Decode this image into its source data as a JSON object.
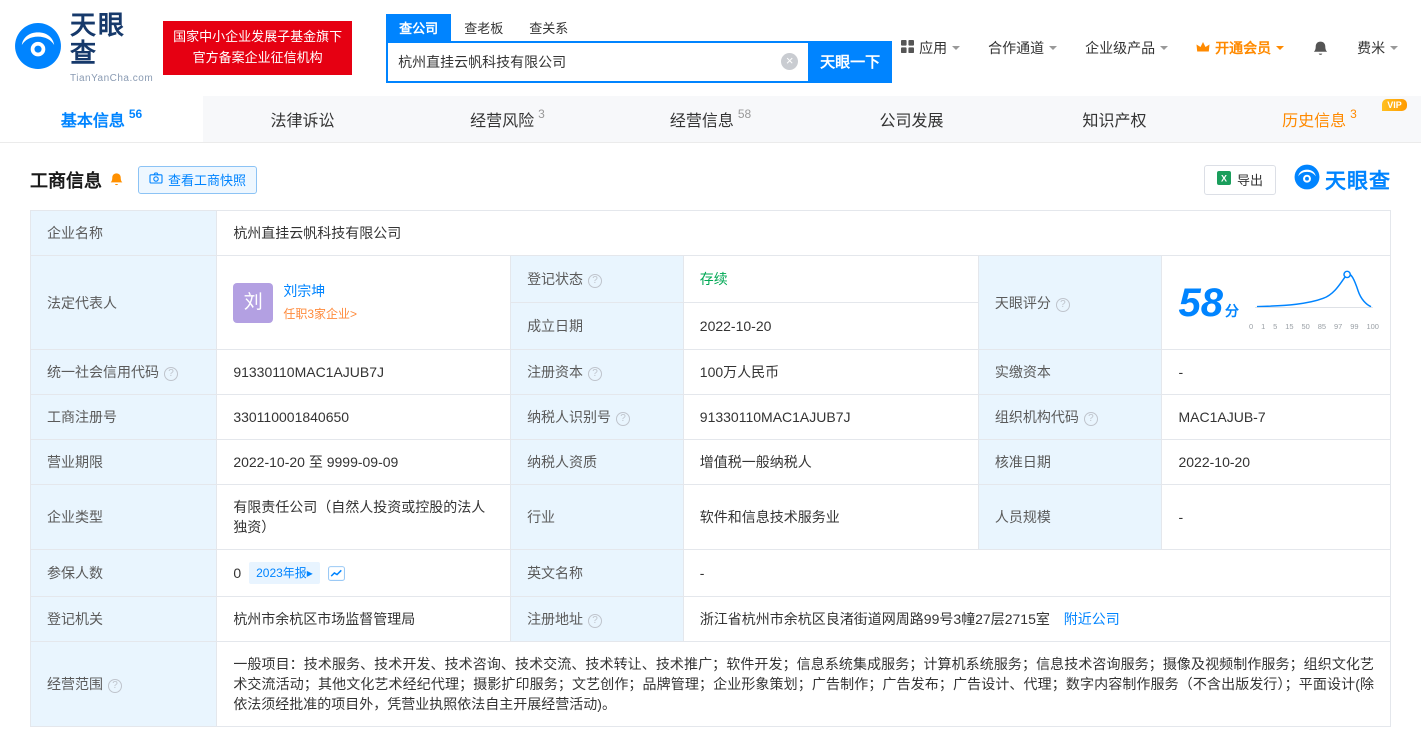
{
  "brand": {
    "logo_text": "天眼查",
    "logo_domain": "TianYanCha.com",
    "badge_line1": "国家中小企业发展子基金旗下",
    "badge_line2": "官方备案企业征信机构"
  },
  "search": {
    "tabs": [
      {
        "label": "查公司"
      },
      {
        "label": "查老板"
      },
      {
        "label": "查关系"
      }
    ],
    "value": "杭州直挂云帆科技有限公司",
    "button": "天眼一下"
  },
  "nav": {
    "items": [
      {
        "label": "应用"
      },
      {
        "label": "合作通道"
      },
      {
        "label": "企业级产品"
      },
      {
        "label": "开通会员"
      },
      {
        "label": "费米"
      }
    ]
  },
  "tabs": [
    {
      "label": "基本信息",
      "count": "56"
    },
    {
      "label": "法律诉讼",
      "count": ""
    },
    {
      "label": "经营风险",
      "count": "3"
    },
    {
      "label": "经营信息",
      "count": "58"
    },
    {
      "label": "公司发展",
      "count": ""
    },
    {
      "label": "知识产权",
      "count": ""
    },
    {
      "label": "历史信息",
      "count": "3",
      "vip": "VIP"
    }
  ],
  "section": {
    "title": "工商信息",
    "snapshot_button": "查看工商快照",
    "export_button": "导出",
    "logo_text": "天眼查"
  },
  "info": {
    "company_name": {
      "label": "企业名称",
      "value": "杭州直挂云帆科技有限公司"
    },
    "legal_rep": {
      "label": "法定代表人",
      "avatar": "刘",
      "name": "刘宗坤",
      "link": "任职3家企业>"
    },
    "reg_status": {
      "label": "登记状态",
      "value": "存续"
    },
    "establish_date": {
      "label": "成立日期",
      "value": "2022-10-20"
    },
    "score": {
      "label": "天眼评分",
      "value": "58",
      "unit": "分",
      "axis": [
        "0",
        "1",
        "5",
        "15",
        "50",
        "85",
        "97",
        "99",
        "100"
      ]
    },
    "credit_code": {
      "label": "统一社会信用代码",
      "value": "91330110MAC1AJUB7J"
    },
    "reg_capital": {
      "label": "注册资本",
      "value": "100万人民币"
    },
    "paid_capital": {
      "label": "实缴资本",
      "value": "-"
    },
    "reg_number": {
      "label": "工商注册号",
      "value": "330110001840650"
    },
    "taxpayer_id": {
      "label": "纳税人识别号",
      "value": "91330110MAC1AJUB7J"
    },
    "org_code": {
      "label": "组织机构代码",
      "value": "MAC1AJUB-7"
    },
    "business_term": {
      "label": "营业期限",
      "value": "2022-10-20 至 9999-09-09"
    },
    "taxpayer_quality": {
      "label": "纳税人资质",
      "value": "增值税一般纳税人"
    },
    "approval_date": {
      "label": "核准日期",
      "value": "2022-10-20"
    },
    "company_type": {
      "label": "企业类型",
      "value": "有限责任公司（自然人投资或控股的法人独资）"
    },
    "industry": {
      "label": "行业",
      "value": "软件和信息技术服务业"
    },
    "staff_size": {
      "label": "人员规模",
      "value": "-"
    },
    "insured": {
      "label": "参保人数",
      "value": "0",
      "report_tag": "2023年报▸"
    },
    "english_name": {
      "label": "英文名称",
      "value": "-"
    },
    "reg_authority": {
      "label": "登记机关",
      "value": "杭州市余杭区市场监督管理局"
    },
    "reg_address": {
      "label": "注册地址",
      "value": "浙江省杭州市余杭区良渚街道网周路99号3幢27层2715室",
      "link": "附近公司"
    },
    "business_scope": {
      "label": "经营范围",
      "value": "一般项目：技术服务、技术开发、技术咨询、技术交流、技术转让、技术推广；软件开发；信息系统集成服务；计算机系统服务；信息技术咨询服务；摄像及视频制作服务；组织文化艺术交流活动；其他文化艺术经纪代理；摄影扩印服务；文艺创作；品牌管理；企业形象策划；广告制作；广告发布；广告设计、代理；数字内容制作服务（不含出版发行）；平面设计(除依法须经批准的项目外，凭营业执照依法自主开展经营活动)。"
    }
  },
  "colors": {
    "accent": "#0084ff",
    "orange": "#ff8a00",
    "green": "#00a854",
    "red": "#e60012"
  }
}
